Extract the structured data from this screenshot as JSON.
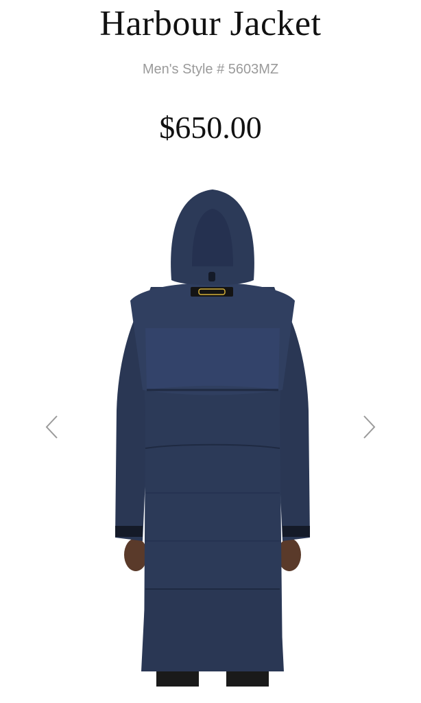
{
  "product": {
    "name": "Harbour Jacket",
    "style_number": "Men's Style # 5603MZ",
    "price": "$650.00"
  },
  "gallery": {
    "image_subject": "jacket-back-view",
    "prev_icon": "chevron-left-icon",
    "next_icon": "chevron-right-icon"
  },
  "colors": {
    "jacket": "#2c3a58",
    "jacket_shadow": "#1f2a42",
    "jacket_highlight": "#3b4a6b",
    "arrow": "#9a9a9a",
    "badge": "#d4b03a"
  }
}
